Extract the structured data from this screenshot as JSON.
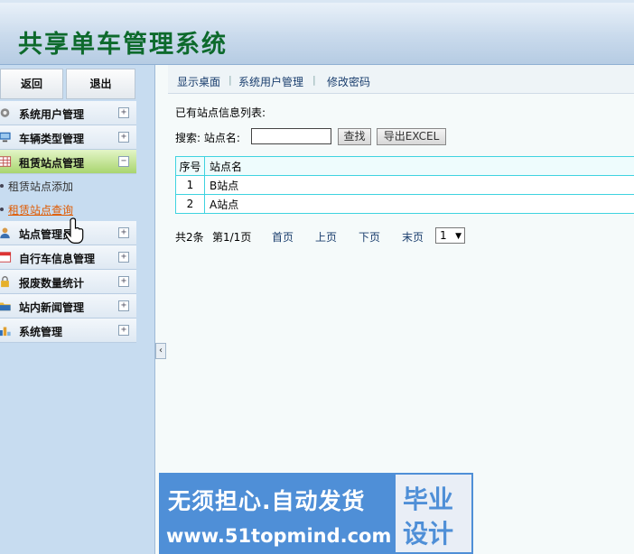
{
  "header": {
    "title": "共享单车管理系统"
  },
  "sidebar": {
    "top_buttons": {
      "back": "返回",
      "logout": "退出"
    },
    "items": [
      {
        "label": "系统用户管理",
        "toggle": "+",
        "icon": "gear-icon"
      },
      {
        "label": "车辆类型管理",
        "toggle": "+",
        "icon": "monitor-icon"
      },
      {
        "label": "租赁站点管理",
        "toggle": "−",
        "icon": "table-icon"
      }
    ],
    "subitems": [
      {
        "label": "租赁站点添加"
      },
      {
        "label": "租赁站点查询"
      }
    ],
    "items2": [
      {
        "label": "站点管理员",
        "toggle": "+",
        "icon": "user-icon"
      },
      {
        "label": "自行车信息管理",
        "toggle": "+",
        "icon": "calendar-icon"
      },
      {
        "label": "报废数量统计",
        "toggle": "+",
        "icon": "lock-icon"
      },
      {
        "label": "站内新闻管理",
        "toggle": "+",
        "icon": "folder-icon"
      },
      {
        "label": "系统管理",
        "toggle": "+",
        "icon": "chart-icon"
      }
    ],
    "collapse_glyph": "‹"
  },
  "content": {
    "top_links": [
      "显示桌面",
      "系统用户管理",
      "修改密码"
    ],
    "separator": "|",
    "list_label": "已有站点信息列表:",
    "search": {
      "label": "搜索: 站点名:",
      "value": "",
      "find_button": "查找",
      "export_button": "导出EXCEL"
    },
    "table": {
      "headers": [
        "序号",
        "站点名"
      ],
      "rows": [
        [
          "1",
          "B站点"
        ],
        [
          "2",
          "A站点"
        ]
      ]
    },
    "pager": {
      "total": "共2条",
      "page": "第1/1页",
      "first": "首页",
      "prev": "上页",
      "next": "下页",
      "last": "末页",
      "select_value": "1"
    }
  },
  "watermark": {
    "line1": "无须担心.自动发货",
    "line2": "www.51topmind.com",
    "badge_line1": "毕业",
    "badge_line2": "设计"
  }
}
